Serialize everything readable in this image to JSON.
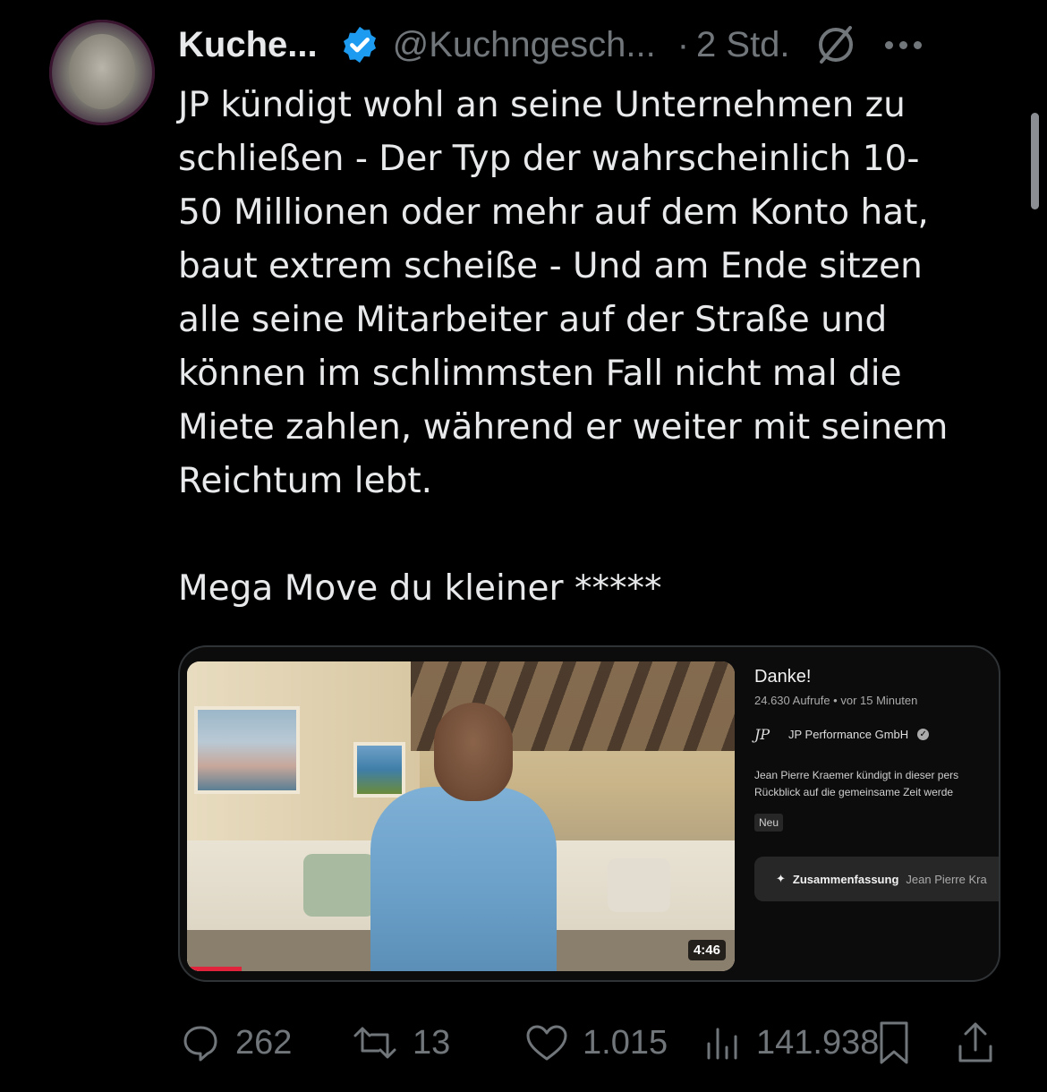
{
  "tweet": {
    "author_name": "Kuche...",
    "author_handle": "@Kuchngesch...",
    "separator": "·",
    "time": "2 Std.",
    "text": "JP kündigt wohl an seine Unternehmen zu\nschließen - Der Typ der wahrscheinlich 10-\n50 Millionen oder mehr auf dem Konto hat,\nbaut extrem scheiße - Und am Ende sitzen\nalle seine Mitarbeiter auf der Straße und\nkönnen im schlimmsten Fall nicht mal die\nMiete zahlen, während er weiter mit seinem\nReichtum lebt.\n\nMega Move du kleiner *****"
  },
  "embed": {
    "video_title": "Danke!",
    "video_meta": "24.630 Aufrufe • vor 15 Minuten",
    "channel_logo": "JP",
    "channel_name": "JP Performance GmbH",
    "description_line1": "Jean Pierre Kraemer kündigt in dieser pers",
    "description_line2": "Rückblick auf die gemeinsame Zeit werde",
    "badge": "Neu",
    "summary_label": "Zusammenfassung",
    "summary_extra": "Jean Pierre Kra",
    "duration": "4:46",
    "progress_fraction": 0.1
  },
  "actions": {
    "replies": "262",
    "reposts": "13",
    "likes": "1.015",
    "views": "141.938"
  },
  "colors": {
    "background": "#000000",
    "text": "#e7e9ea",
    "muted": "#71767b",
    "verified": "#1d9bf0",
    "progress": "#e1243b"
  },
  "icons": [
    "verified-badge-icon",
    "no-entry-icon",
    "more-icon",
    "reply-icon",
    "repost-icon",
    "like-icon",
    "views-icon",
    "bookmark-icon",
    "share-icon"
  ]
}
